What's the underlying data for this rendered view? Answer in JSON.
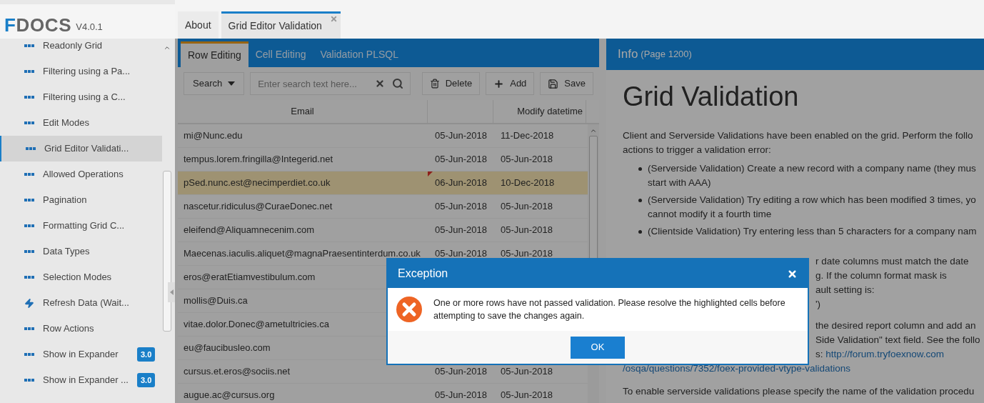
{
  "app": {
    "logo_initial": "F",
    "logo_rest": "DOCS",
    "version": "V4.0.1"
  },
  "sidebar": {
    "items": [
      {
        "label": "Readonly Grid",
        "kind": "dots",
        "selected": false
      },
      {
        "label": "Filtering using a Pa...",
        "kind": "dots",
        "selected": false
      },
      {
        "label": "Filtering using a C...",
        "kind": "dots",
        "selected": false
      },
      {
        "label": "Edit Modes",
        "kind": "dots",
        "selected": false
      },
      {
        "label": "Grid Editor Validati...",
        "kind": "dots",
        "selected": true
      },
      {
        "label": "Allowed Operations",
        "kind": "dots",
        "selected": false
      },
      {
        "label": "Pagination",
        "kind": "dots",
        "selected": false
      },
      {
        "label": "Formatting Grid C...",
        "kind": "dots",
        "selected": false
      },
      {
        "label": "Data Types",
        "kind": "dots",
        "selected": false
      },
      {
        "label": "Selection Modes",
        "kind": "dots",
        "selected": false
      },
      {
        "label": "Refresh Data (Wait...",
        "kind": "bolt",
        "selected": false
      },
      {
        "label": "Row Actions",
        "kind": "dots",
        "selected": false
      },
      {
        "label": "Show in Expander",
        "kind": "dots",
        "selected": false,
        "badge": "3.0"
      },
      {
        "label": "Show in Expander ...",
        "kind": "dots",
        "selected": false,
        "badge": "3.0"
      }
    ]
  },
  "page_tabs": [
    {
      "label": "About",
      "selected": false,
      "closable": false
    },
    {
      "label": "Grid Editor Validation",
      "selected": true,
      "closable": true
    }
  ],
  "grid": {
    "tabs": [
      {
        "label": "Row Editing",
        "selected": true
      },
      {
        "label": "Cell Editing",
        "selected": false
      },
      {
        "label": "Validation PLSQL",
        "selected": false
      }
    ],
    "toolbar": {
      "search_menu": "Search",
      "search_placeholder": "Enter search text here...",
      "delete": "Delete",
      "add": "Add",
      "save": "Save"
    },
    "columns": [
      "Email",
      "Modify datetime"
    ],
    "rows": [
      {
        "email": "mi@Nunc.edu",
        "date_1": "05-Jun-2018",
        "date_2": "11-Dec-2018",
        "selected": false,
        "error": false
      },
      {
        "email": "tempus.lorem.fringilla@Integerid.net",
        "date_1": "05-Jun-2018",
        "date_2": "05-Jun-2018",
        "selected": false,
        "error": false
      },
      {
        "email": "pSed.nunc.est@necimperdiet.co.uk",
        "date_1": "06-Jun-2018",
        "date_2": "10-Dec-2018",
        "selected": true,
        "error": true
      },
      {
        "email": "nascetur.ridiculus@CuraeDonec.net",
        "date_1": "05-Jun-2018",
        "date_2": "05-Jun-2018",
        "selected": false,
        "error": false
      },
      {
        "email": "eleifend@Aliquamnecenim.com",
        "date_1": "05-Jun-2018",
        "date_2": "05-Jun-2018",
        "selected": false,
        "error": false
      },
      {
        "email": "Maecenas.iaculis.aliquet@magnaPraesentinterdum.co.uk",
        "date_1": "05-Jun-2018",
        "date_2": "05-Jun-2018",
        "selected": false,
        "error": false
      },
      {
        "email": "eros@eratEtiamvestibulum.com",
        "selected": false
      },
      {
        "email": "mollis@Duis.ca",
        "selected": false
      },
      {
        "email": "vitae.dolor.Donec@ametultricies.ca",
        "selected": false
      },
      {
        "email": "eu@faucibusleo.com",
        "selected": false
      },
      {
        "email": "cursus.et.eros@sociis.net",
        "date_1": "05-Jun-2018",
        "date_2": "05-Jun-2018",
        "selected": false
      },
      {
        "email": "augue.ac@cursus.org",
        "date_1": "05-Jun-2018",
        "date_2": "05-Jun-2018",
        "selected": false,
        "error": false
      }
    ]
  },
  "info": {
    "title": "Info",
    "page": "(Page 1200)",
    "heading": "Grid Validation",
    "intro": "Client and Serverside Validations have been enabled on the grid. Perform the follo\nactions to trigger a validation error:",
    "bullets": [
      "(Serverside Validation) Create a new record with a company name (they mus\nstart with AAA)",
      "(Serverside Validation) Try editing a row which has been modified 3 times, yo\ncannot modify it a fourth time",
      "(Clientside Validation) Try entering less than 5 characters for a company nam"
    ],
    "fragment_1": "r date columns must match the date\ng. If the column format mask is\nault setting is:\n')",
    "fragment_2": "the desired report column and add an\nSide Validation\" text field. See the follo",
    "fragment_3": "s: ",
    "link_1": "http://forum.tryfoexnow.com",
    "link_2": "/osqa/questions/7352/foex-provided-vtype-validations",
    "outro": "To enable serverside validations please specify the name of the validation procedu"
  },
  "dialog": {
    "title": "Exception",
    "message": "One or more rows have not passed validation. Please resolve the highlighted cells before attempting to save the changes again.",
    "ok": "OK"
  }
}
